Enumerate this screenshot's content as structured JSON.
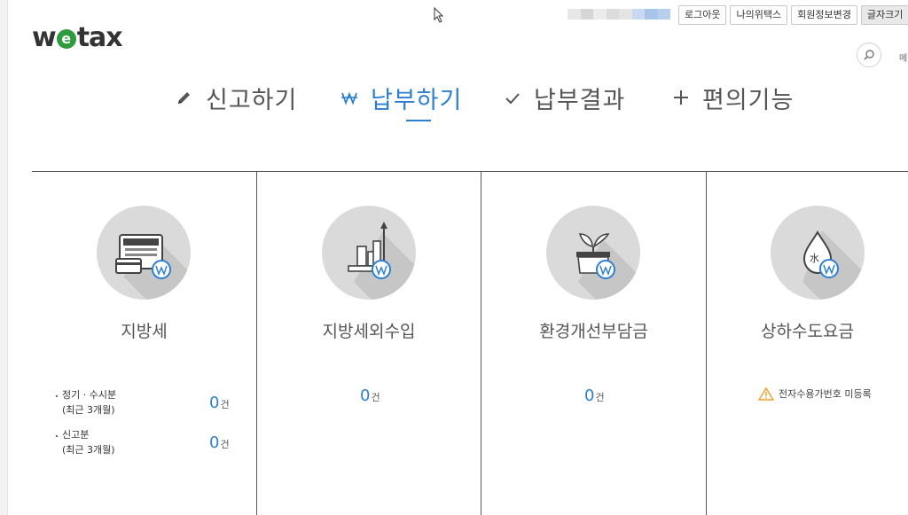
{
  "header": {
    "logo_left": "w",
    "logo_e": "e",
    "logo_right": "tax",
    "top_links": [
      "로그아웃",
      "나의위택스",
      "회원정보변경",
      "글자크기"
    ],
    "menu_cut": "메"
  },
  "nav": {
    "items": [
      {
        "label": "신고하기",
        "icon": "pencil-icon"
      },
      {
        "label": "납부하기",
        "icon": "won-icon"
      },
      {
        "label": "납부결과",
        "icon": "check-icon"
      },
      {
        "label": "편의기능",
        "icon": "plus-icon"
      }
    ],
    "active_index": 1
  },
  "cards": [
    {
      "title": "지방세",
      "icon": "card-payment-won-icon",
      "rows": [
        {
          "label_line1": "정기 · 수시분",
          "label_line2": "(최근 3개월)",
          "count": "0",
          "unit": "건"
        },
        {
          "label_line1": "신고분",
          "label_line2": "(최근 3개월)",
          "count": "0",
          "unit": "건"
        }
      ]
    },
    {
      "title": "지방세외수입",
      "icon": "buildings-won-icon",
      "count": "0",
      "unit": "건"
    },
    {
      "title": "환경개선부담금",
      "icon": "plant-pot-won-icon",
      "count": "0",
      "unit": "건"
    },
    {
      "title": "상하수도요금",
      "icon": "water-drop-won-icon",
      "drop_label": "水",
      "warning": "전자수용가번호 미등록"
    }
  ],
  "colors": {
    "accent": "#2d7fd1",
    "logo_green": "#2e9b3e",
    "warning": "#f0a030"
  }
}
